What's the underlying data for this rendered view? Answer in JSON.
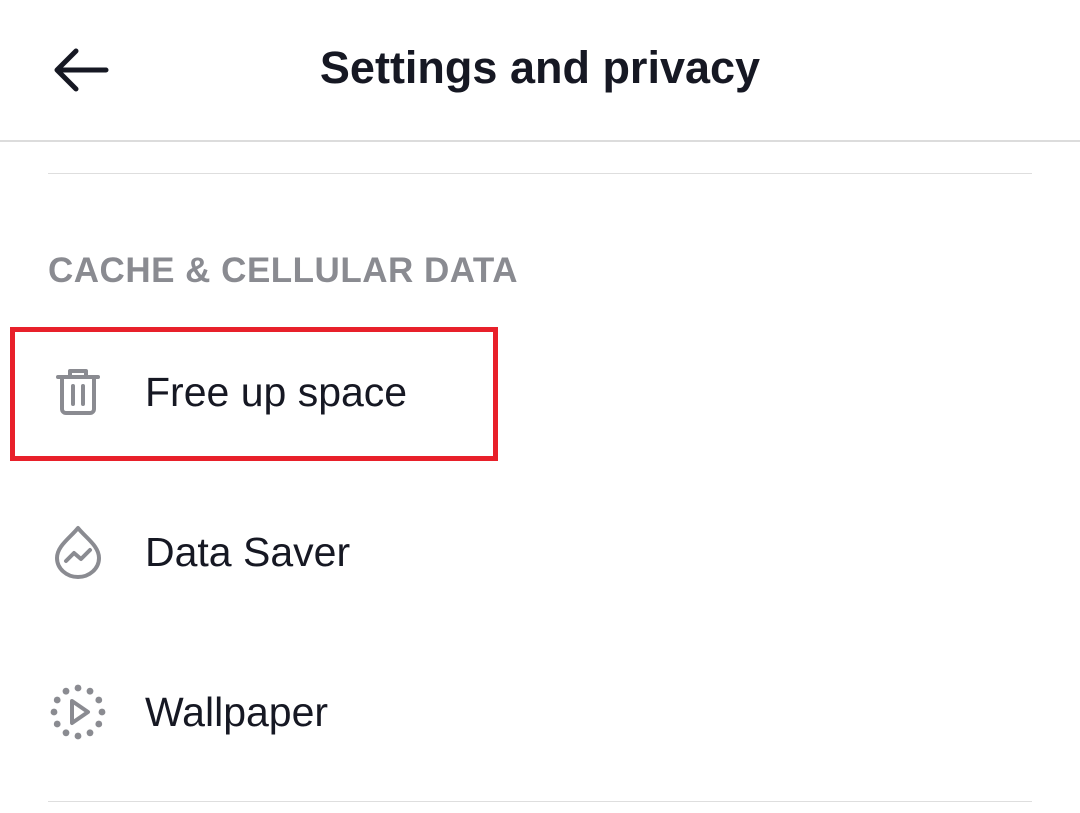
{
  "header": {
    "title": "Settings and privacy",
    "back_icon": "arrow-left-icon"
  },
  "section": {
    "title": "CACHE & CELLULAR DATA",
    "items": [
      {
        "label": "Free up space",
        "icon": "trash-icon",
        "highlighted": true
      },
      {
        "label": "Data Saver",
        "icon": "data-saver-drop-icon",
        "highlighted": false
      },
      {
        "label": "Wallpaper",
        "icon": "wallpaper-play-icon",
        "highlighted": false
      }
    ]
  },
  "colors": {
    "text_primary": "#161823",
    "text_secondary": "#8a8b91",
    "icon": "#8a8b91",
    "highlight": "#e8202a",
    "divider": "#dedede"
  }
}
